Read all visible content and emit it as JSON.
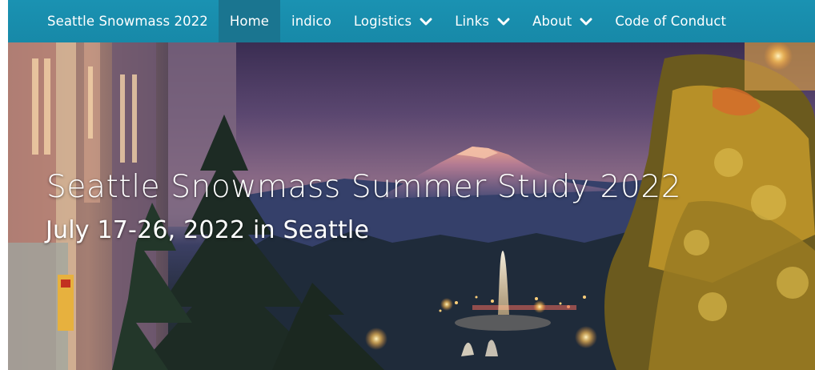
{
  "nav": {
    "brand": "Seattle Snowmass 2022",
    "items": [
      {
        "label": "Home",
        "active": true,
        "dropdown": false
      },
      {
        "label": "indico",
        "active": false,
        "dropdown": false
      },
      {
        "label": "Logistics",
        "active": false,
        "dropdown": true
      },
      {
        "label": "Links",
        "active": false,
        "dropdown": true
      },
      {
        "label": "About",
        "active": false,
        "dropdown": true
      },
      {
        "label": "Code of Conduct",
        "active": false,
        "dropdown": false
      }
    ],
    "dropdown_icon": "chevron-down-icon"
  },
  "hero": {
    "title": "Seattle Snowmass Summer Study 2022",
    "subtitle": "July 17-26, 2022 in Seattle",
    "background_image": "mountain-fountain-campus-photo"
  },
  "colors": {
    "navbar": "#1a92b2",
    "navbar_active": "#1a7590",
    "text": "#ffffff"
  }
}
